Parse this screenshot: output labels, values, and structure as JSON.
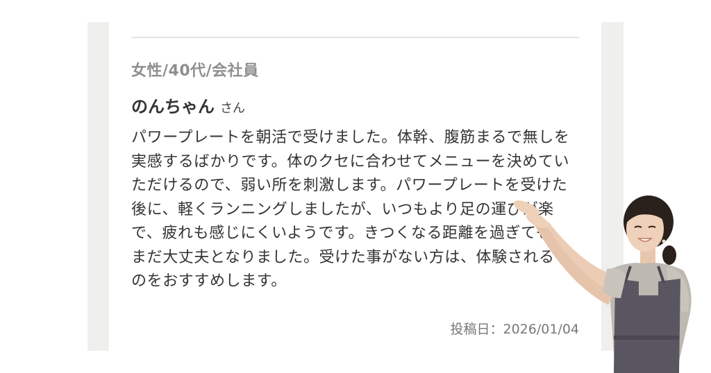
{
  "review": {
    "meta": "女性/40代/会社員",
    "name": "のんちゃん",
    "honorific": "さん",
    "body": "パワープレートを朝活で受けました。体幹、腹筋まるで無しを実感するばかりです。体のクセに合わせてメニューを決めていただけるので、弱い所を刺激します。パワープレートを受けた後に、軽くランニングしましたが、いつもより足の運びが楽で、疲れも感じにくいようです。きつくなる距離を過ぎても、まだ大丈夫となりました。受けた事がない方は、体験されるのをおすすめします。",
    "date": "投稿日：2026/01/04"
  },
  "colors": {
    "frame": "#efefed",
    "meta_text": "#8f8f8f",
    "body_text": "#333333",
    "apron": "#5a5661",
    "blouse": "#b9b5ad"
  }
}
